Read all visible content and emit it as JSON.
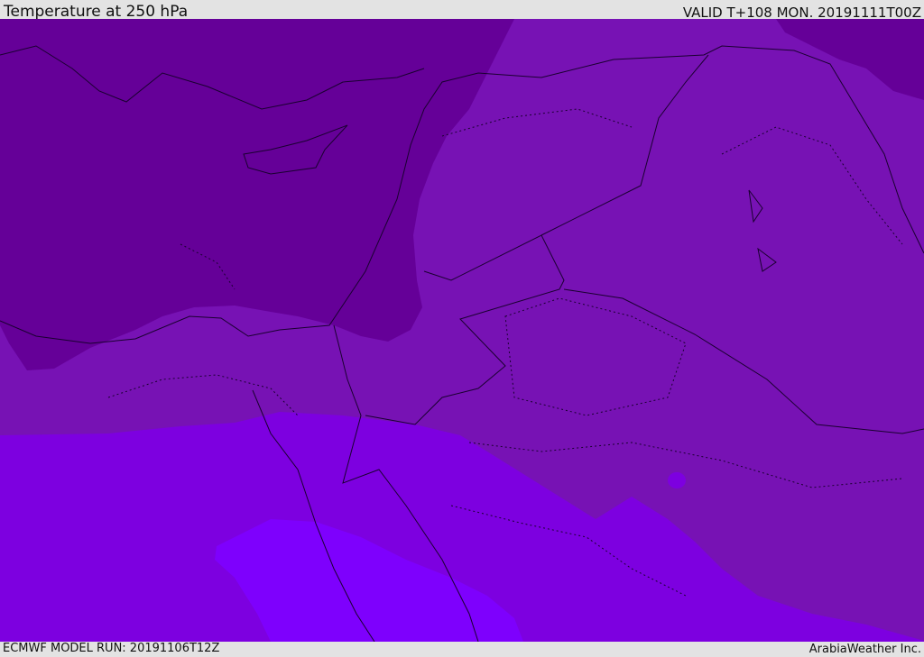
{
  "header": {
    "title": "Temperature at 250 hPa",
    "valid": "VALID T+108 MON. 20191111T00Z"
  },
  "footer": {
    "model_run": "ECMWF MODEL RUN: 20191106T12Z",
    "credit": "ArabiaWeather Inc."
  },
  "map": {
    "colors": {
      "coldest": "#650098",
      "cold": "#7712b4",
      "mid": "#7d00e0",
      "warm": "#7e00fd",
      "coast_line": "#1a0030"
    }
  }
}
